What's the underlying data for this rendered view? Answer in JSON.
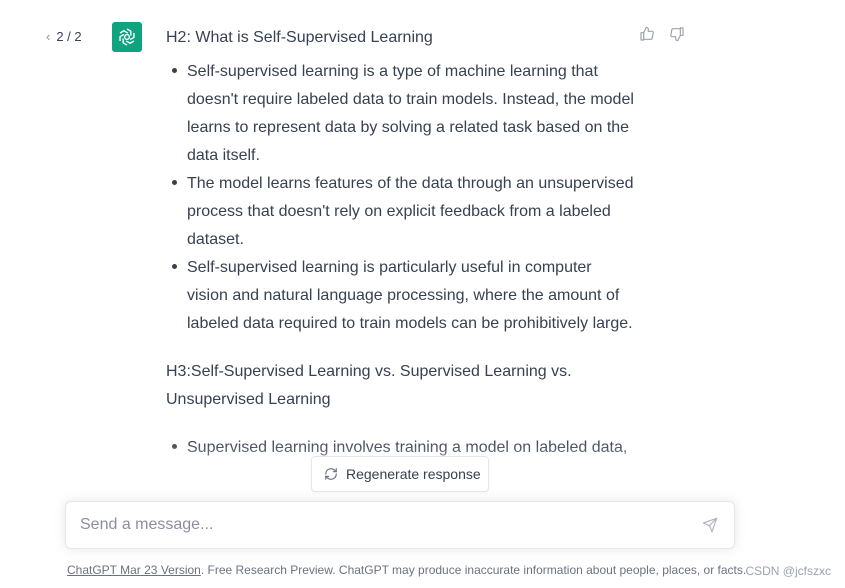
{
  "pager": {
    "prev_icon": "chevron-left-icon",
    "current": "2 / 2",
    "next_icon": "chevron-right-icon"
  },
  "assistant": {
    "avatar_icon": "openai-logo-icon",
    "avatar_color": "#10a37f"
  },
  "feedback": {
    "like_icon": "thumbs-up-icon",
    "dislike_icon": "thumbs-down-icon"
  },
  "message": {
    "heading": "H2: What is Self-Supervised Learning",
    "bullets": [
      "Self-supervised learning is a type of machine learning that doesn't require labeled data to train models. Instead, the model learns to represent data by solving a related task based on the data itself.",
      "The model learns features of the data through an unsupervised process that doesn't rely on explicit feedback from a labeled dataset.",
      "Self-supervised learning is particularly useful in computer vision and natural language processing, where the amount of labeled data required to train models can be prohibitively large."
    ],
    "subheading": "H3:Self-Supervised Learning vs. Supervised Learning vs. Unsupervised Learning",
    "bullets2": [
      "Supervised learning involves training a model on labeled data,"
    ]
  },
  "regenerate": {
    "label": "Regenerate response",
    "icon": "refresh-icon"
  },
  "composer": {
    "placeholder": "Send a message...",
    "send_icon": "send-icon"
  },
  "footer": {
    "link_text": "ChatGPT Mar 23 Version",
    "text": ". Free Research Preview. ChatGPT may produce inaccurate information about people, places, or facts."
  },
  "watermark": "CSDN @jcfszxc"
}
